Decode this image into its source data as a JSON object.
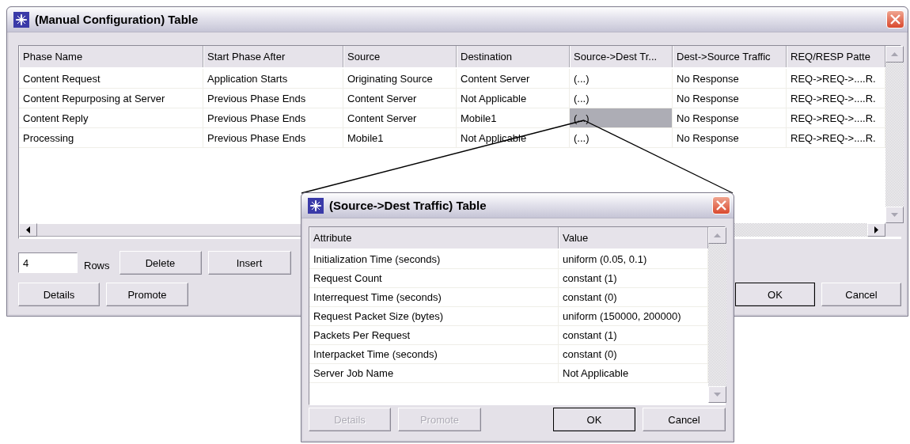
{
  "main_window": {
    "title": "(Manual Configuration) Table",
    "table": {
      "columns": [
        "Phase Name",
        "Start Phase After",
        "Source",
        "Destination",
        "Source->Dest Tr...",
        "Dest->Source Traffic",
        "REQ/RESP Patte"
      ],
      "rows": [
        {
          "cells": [
            {
              "text": "Content Request",
              "selected": false
            },
            {
              "text": "Application Starts",
              "selected": false
            },
            {
              "text": "Originating Source",
              "selected": false
            },
            {
              "text": "Content Server",
              "selected": false
            },
            {
              "text": "(...)",
              "selected": false
            },
            {
              "text": "No Response",
              "selected": false
            },
            {
              "text": "REQ->REQ->....R.",
              "selected": false
            }
          ]
        },
        {
          "cells": [
            {
              "text": "Content Repurposing at Server",
              "selected": false
            },
            {
              "text": "Previous Phase Ends",
              "selected": false
            },
            {
              "text": "Content Server",
              "selected": false
            },
            {
              "text": "Not Applicable",
              "selected": false
            },
            {
              "text": "(...)",
              "selected": false
            },
            {
              "text": "No Response",
              "selected": false
            },
            {
              "text": "REQ->REQ->....R.",
              "selected": false
            }
          ]
        },
        {
          "cells": [
            {
              "text": "Content Reply",
              "selected": false
            },
            {
              "text": "Previous Phase Ends",
              "selected": false
            },
            {
              "text": "Content Server",
              "selected": false
            },
            {
              "text": "Mobile1",
              "selected": false
            },
            {
              "text": "(...)",
              "selected": true
            },
            {
              "text": "No Response",
              "selected": false
            },
            {
              "text": "REQ->REQ->....R.",
              "selected": false
            }
          ]
        },
        {
          "cells": [
            {
              "text": "Processing",
              "selected": false
            },
            {
              "text": "Previous Phase Ends",
              "selected": false
            },
            {
              "text": "Mobile1",
              "selected": false
            },
            {
              "text": "Not Applicable",
              "selected": false
            },
            {
              "text": "(...)",
              "selected": false
            },
            {
              "text": "No Response",
              "selected": false
            },
            {
              "text": "REQ->REQ->....R.",
              "selected": false
            }
          ]
        }
      ]
    },
    "rows_field": {
      "value": "4",
      "label": "Rows"
    },
    "delete_button": {
      "label": "Delete",
      "disabled": false,
      "default": false
    },
    "insert_button": {
      "label": "Insert",
      "disabled": false,
      "default": false
    },
    "details_button": {
      "label": "Details",
      "disabled": false,
      "default": false
    },
    "promote_button": {
      "label": "Promote",
      "disabled": false,
      "default": false
    },
    "ok_button": {
      "label": "OK",
      "disabled": false,
      "default": true
    },
    "cancel_button": {
      "label": "Cancel",
      "disabled": false,
      "default": false
    }
  },
  "traffic_dialog": {
    "title": "(Source->Dest Traffic) Table",
    "table": {
      "columns": [
        "Attribute",
        "Value"
      ],
      "rows": [
        {
          "cells": [
            {
              "text": "Initialization Time (seconds)",
              "selected": false
            },
            {
              "text": "uniform (0.05, 0.1)",
              "selected": false
            }
          ]
        },
        {
          "cells": [
            {
              "text": "Request Count",
              "selected": false
            },
            {
              "text": "constant (1)",
              "selected": false
            }
          ]
        },
        {
          "cells": [
            {
              "text": "Interrequest Time (seconds)",
              "selected": false
            },
            {
              "text": "constant (0)",
              "selected": false
            }
          ]
        },
        {
          "cells": [
            {
              "text": "Request Packet Size (bytes)",
              "selected": false
            },
            {
              "text": "uniform (150000, 200000)",
              "selected": false
            }
          ]
        },
        {
          "cells": [
            {
              "text": "Packets Per Request",
              "selected": false
            },
            {
              "text": "constant (1)",
              "selected": false
            }
          ]
        },
        {
          "cells": [
            {
              "text": "Interpacket Time (seconds)",
              "selected": false
            },
            {
              "text": "constant (0)",
              "selected": false
            }
          ]
        },
        {
          "cells": [
            {
              "text": "Server Job Name",
              "selected": false
            },
            {
              "text": "Not Applicable",
              "selected": false
            }
          ]
        }
      ]
    },
    "details_button": {
      "label": "Details",
      "disabled": true,
      "default": false
    },
    "promote_button": {
      "label": "Promote",
      "disabled": true,
      "default": false
    },
    "ok_button": {
      "label": "OK",
      "disabled": false,
      "default": true
    },
    "cancel_button": {
      "label": "Cancel",
      "disabled": false,
      "default": false
    }
  }
}
